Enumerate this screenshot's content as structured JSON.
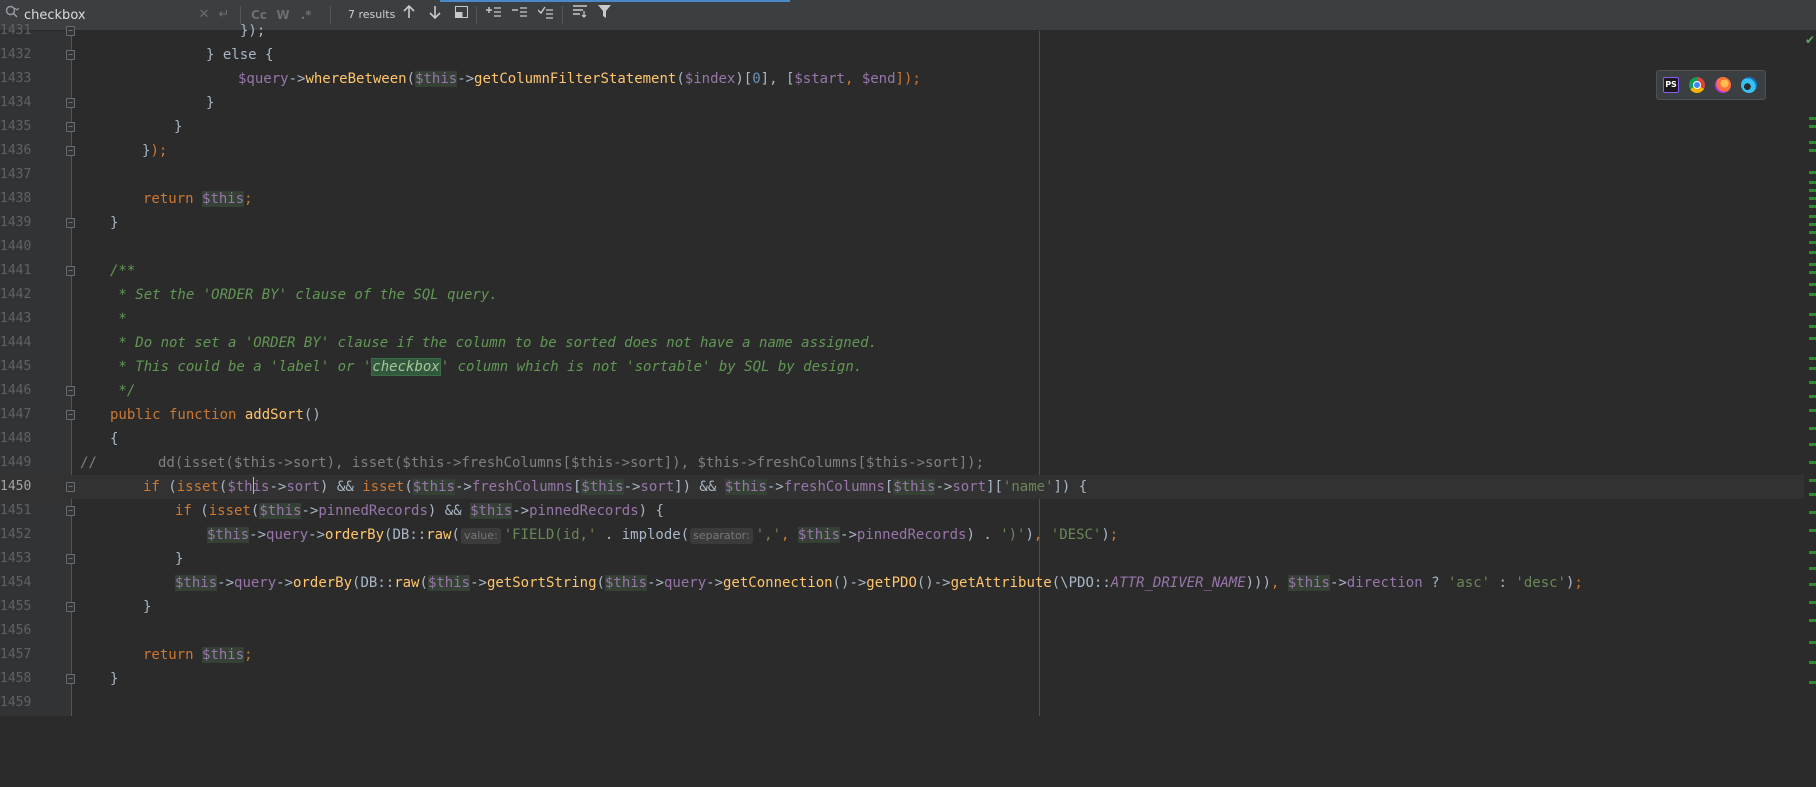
{
  "search": {
    "query": "checkbox",
    "results": "7 results",
    "match_case": "Cc",
    "words": "W",
    "regex": ".*"
  },
  "browsers": [
    "PS",
    "chrome-icon",
    "firefox-icon",
    "edge-icon"
  ],
  "colors": {
    "accent": "#4a88c7",
    "match": "#32593d",
    "keyword": "#cc7832",
    "function": "#ffc66d",
    "variable": "#9876aa",
    "string": "#6a8759",
    "doc": "#629755"
  },
  "editor": {
    "current_line": 1450,
    "lines": [
      {
        "no": "1431"
      },
      {
        "no": "1432"
      },
      {
        "no": "1433"
      },
      {
        "no": "1434"
      },
      {
        "no": "1435"
      },
      {
        "no": "1436"
      },
      {
        "no": "1437"
      },
      {
        "no": "1438"
      },
      {
        "no": "1439"
      },
      {
        "no": "1440"
      },
      {
        "no": "1441"
      },
      {
        "no": "1442"
      },
      {
        "no": "1443"
      },
      {
        "no": "1444"
      },
      {
        "no": "1445"
      },
      {
        "no": "1446"
      },
      {
        "no": "1447"
      },
      {
        "no": "1448"
      },
      {
        "no": "1449"
      },
      {
        "no": "1450"
      },
      {
        "no": "1451"
      },
      {
        "no": "1452"
      },
      {
        "no": "1453"
      },
      {
        "no": "1454"
      },
      {
        "no": "1455"
      },
      {
        "no": "1456"
      },
      {
        "no": "1457"
      },
      {
        "no": "1458"
      },
      {
        "no": "1459"
      }
    ],
    "code": {
      "l1432_else": "} else {",
      "l1433_a": "$query",
      "l1433_b": "->",
      "l1433_c": "whereBetween",
      "l1433_d": "(",
      "l1433_e": "$this",
      "l1433_f": "->",
      "l1433_g": "getColumnFilterStatement",
      "l1433_h": "(",
      "l1433_i": "$index",
      "l1433_j": ")[",
      "l1433_k": "0",
      "l1433_l": "], [",
      "l1433_m": "$start",
      "l1433_n": ", ",
      "l1433_o": "$end",
      "l1433_p": "]);",
      "brace_close": "}",
      "l1436": "});",
      "return_kw": "return",
      "this": "$this",
      "semicolon": ";",
      "doc_open": "/**",
      "doc_1442": " * Set the 'ORDER BY' clause of the SQL query.",
      "doc_1443": " *",
      "doc_1444": " * Do not set a 'ORDER BY' clause if the column to be sorted does not have a name assigned.",
      "doc_1445_a": " * This could be a 'label' or '",
      "doc_1445_match": "checkbox",
      "doc_1445_b": "' column which is not 'sortable' by SQL by design.",
      "doc_close": " */",
      "public_function": "public function",
      "method_name": "addSort",
      "parens": "()",
      "brace_open": "{",
      "comment_slashes": "//",
      "comment_1449": "dd(isset($this->sort), isset($this->freshColumns[$this->sort]), $this->freshColumns[$this->sort]);",
      "if_kw": "if",
      "isset": "isset",
      "arrow": "->",
      "sort": "sort",
      "freshColumns": "freshColumns",
      "pinnedRecords": "pinnedRecords",
      "query": "query",
      "orderBy": "orderBy",
      "DB": "DB::",
      "raw": "raw",
      "hint_value": "value:",
      "str_field": "'FIELD(id,'",
      "dot_implode": " . implode(",
      "hint_separator": "separator:",
      "str_comma": "','",
      "str_paren": "')'",
      "str_desc": "'DESC'",
      "str_name": "'name'",
      "str_asc": "'asc'",
      "str_desc_lower": "'desc'",
      "getSortString": "getSortString",
      "getConnection": "getConnection",
      "getPDO": "getPDO",
      "getAttribute": "getAttribute",
      "pdo_class": "(\\PDO::",
      "attr_const": "ATTR_DRIVER_NAME",
      "direction": "direction"
    }
  }
}
